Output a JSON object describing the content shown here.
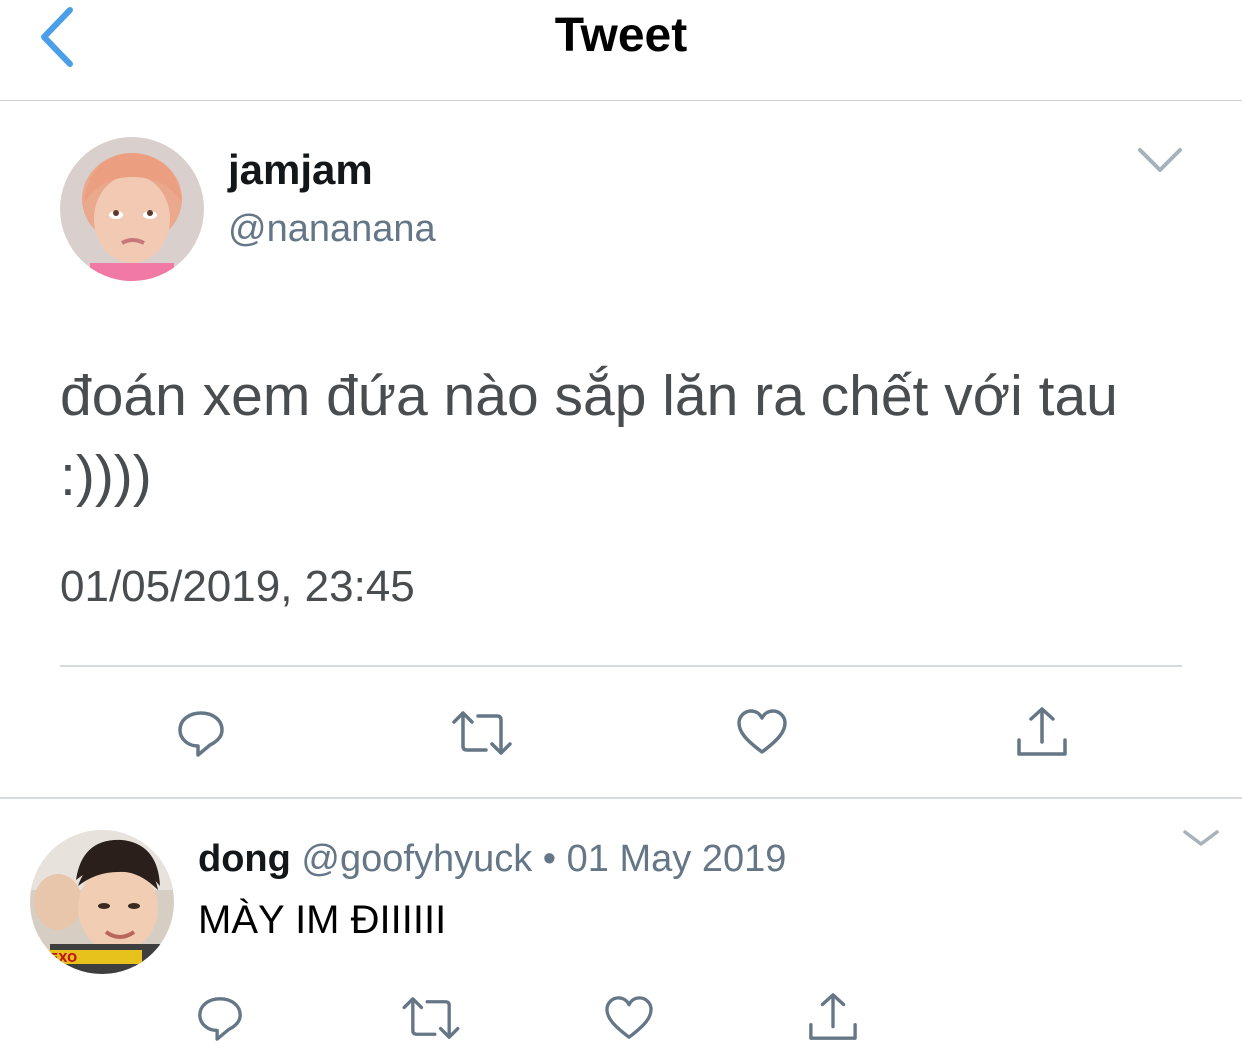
{
  "header": {
    "title": "Tweet",
    "back_icon": "chevron-left-icon",
    "accent": "#4a9fe8"
  },
  "tweet": {
    "author_name": "jamjam",
    "author_handle": "@nananana",
    "text": "đoán xem đứa nào sắp lăn ra chết với tau :))))",
    "timestamp": "01/05/2019, 23:45",
    "menu_icon": "chevron-down-icon"
  },
  "actions": [
    "reply-icon",
    "retweet-icon",
    "like-icon",
    "share-icon"
  ],
  "reply": {
    "author_name": "dong",
    "author_handle": "@goofyhyuck",
    "separator": "•",
    "date": "01 May 2019",
    "text": "MÀY IM ĐIIIIII",
    "menu_icon": "chevron-down-icon",
    "avatar_caption": "EXO"
  }
}
